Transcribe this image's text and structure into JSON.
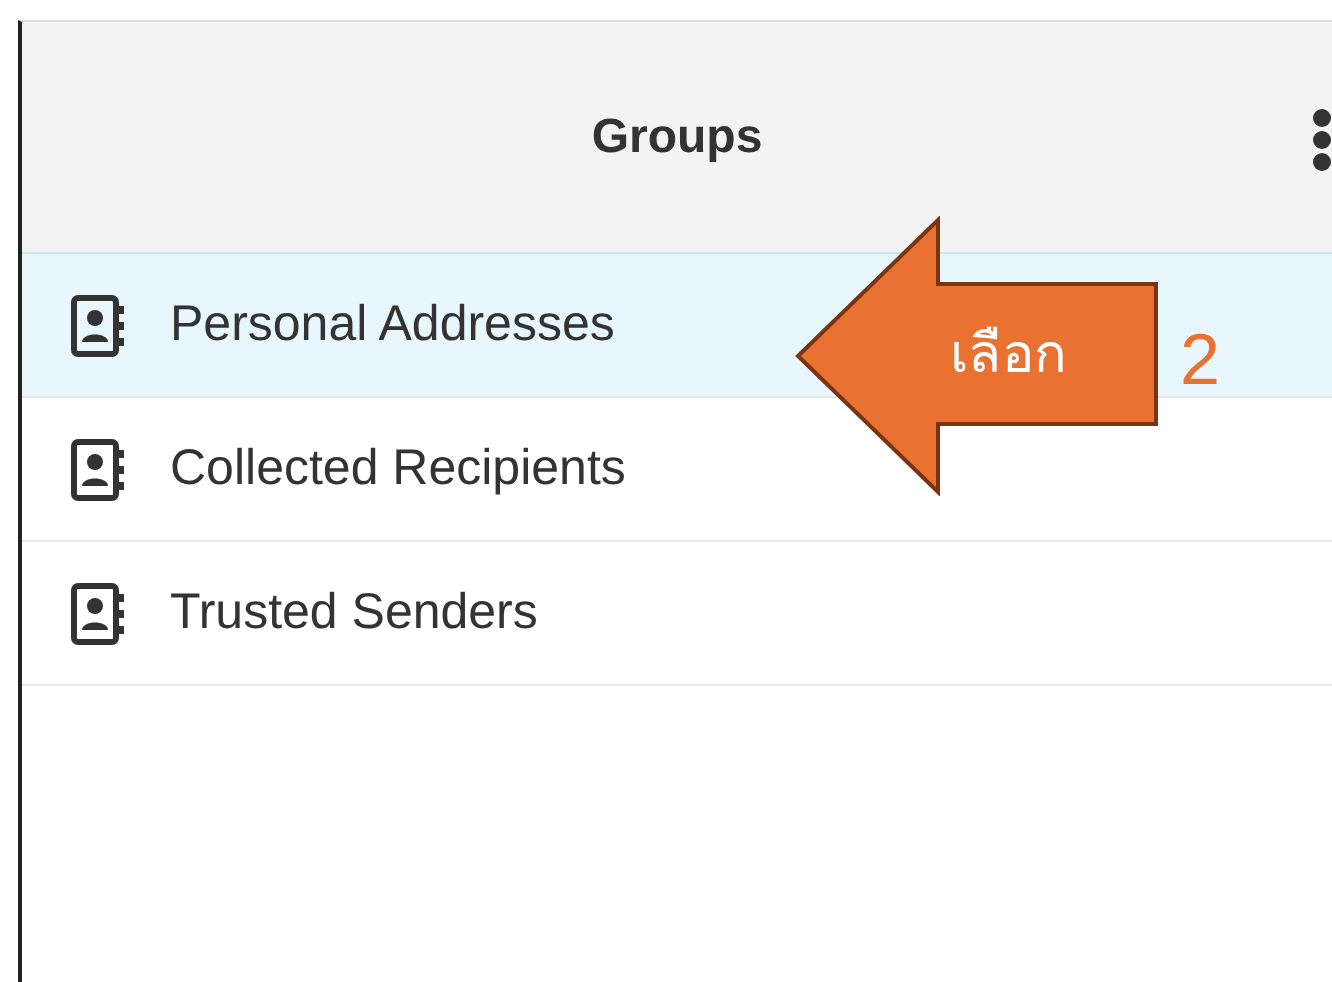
{
  "header": {
    "title": "Groups"
  },
  "groups": [
    {
      "label": "Personal Addresses",
      "selected": true
    },
    {
      "label": "Collected Recipients",
      "selected": false
    },
    {
      "label": "Trusted Senders",
      "selected": false
    }
  ],
  "callout": {
    "label": "เลือก",
    "step": "2"
  }
}
